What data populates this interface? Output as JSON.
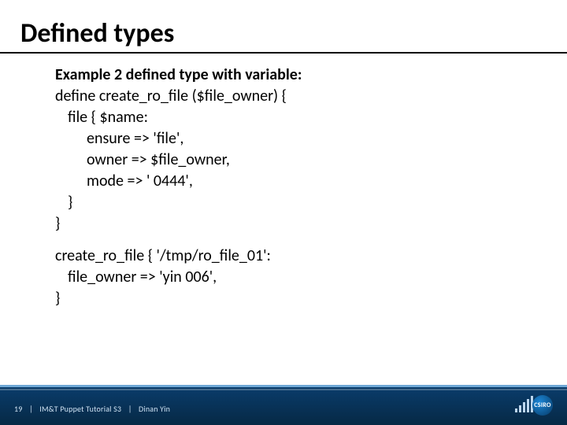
{
  "title": "Defined types",
  "example_heading": "Example 2 defined type with variable:",
  "code1": {
    "l1": "define create_ro_file ($file_owner) {",
    "l2": "file { $name:",
    "l3": "ensure => 'file',",
    "l4": "owner => $file_owner,",
    "l5": "mode => ' 0444',",
    "l6": "}",
    "l7": "}"
  },
  "code2": {
    "l1": "create_ro_file { '/tmp/ro_file_01':",
    "l2": "file_owner => 'yin 006',",
    "l3": "}"
  },
  "footer": {
    "page": "19",
    "section": "IM&T Puppet Tutorial S3",
    "author": "Dinan Yin",
    "sep": "|"
  },
  "logo_text": "CSIRO"
}
